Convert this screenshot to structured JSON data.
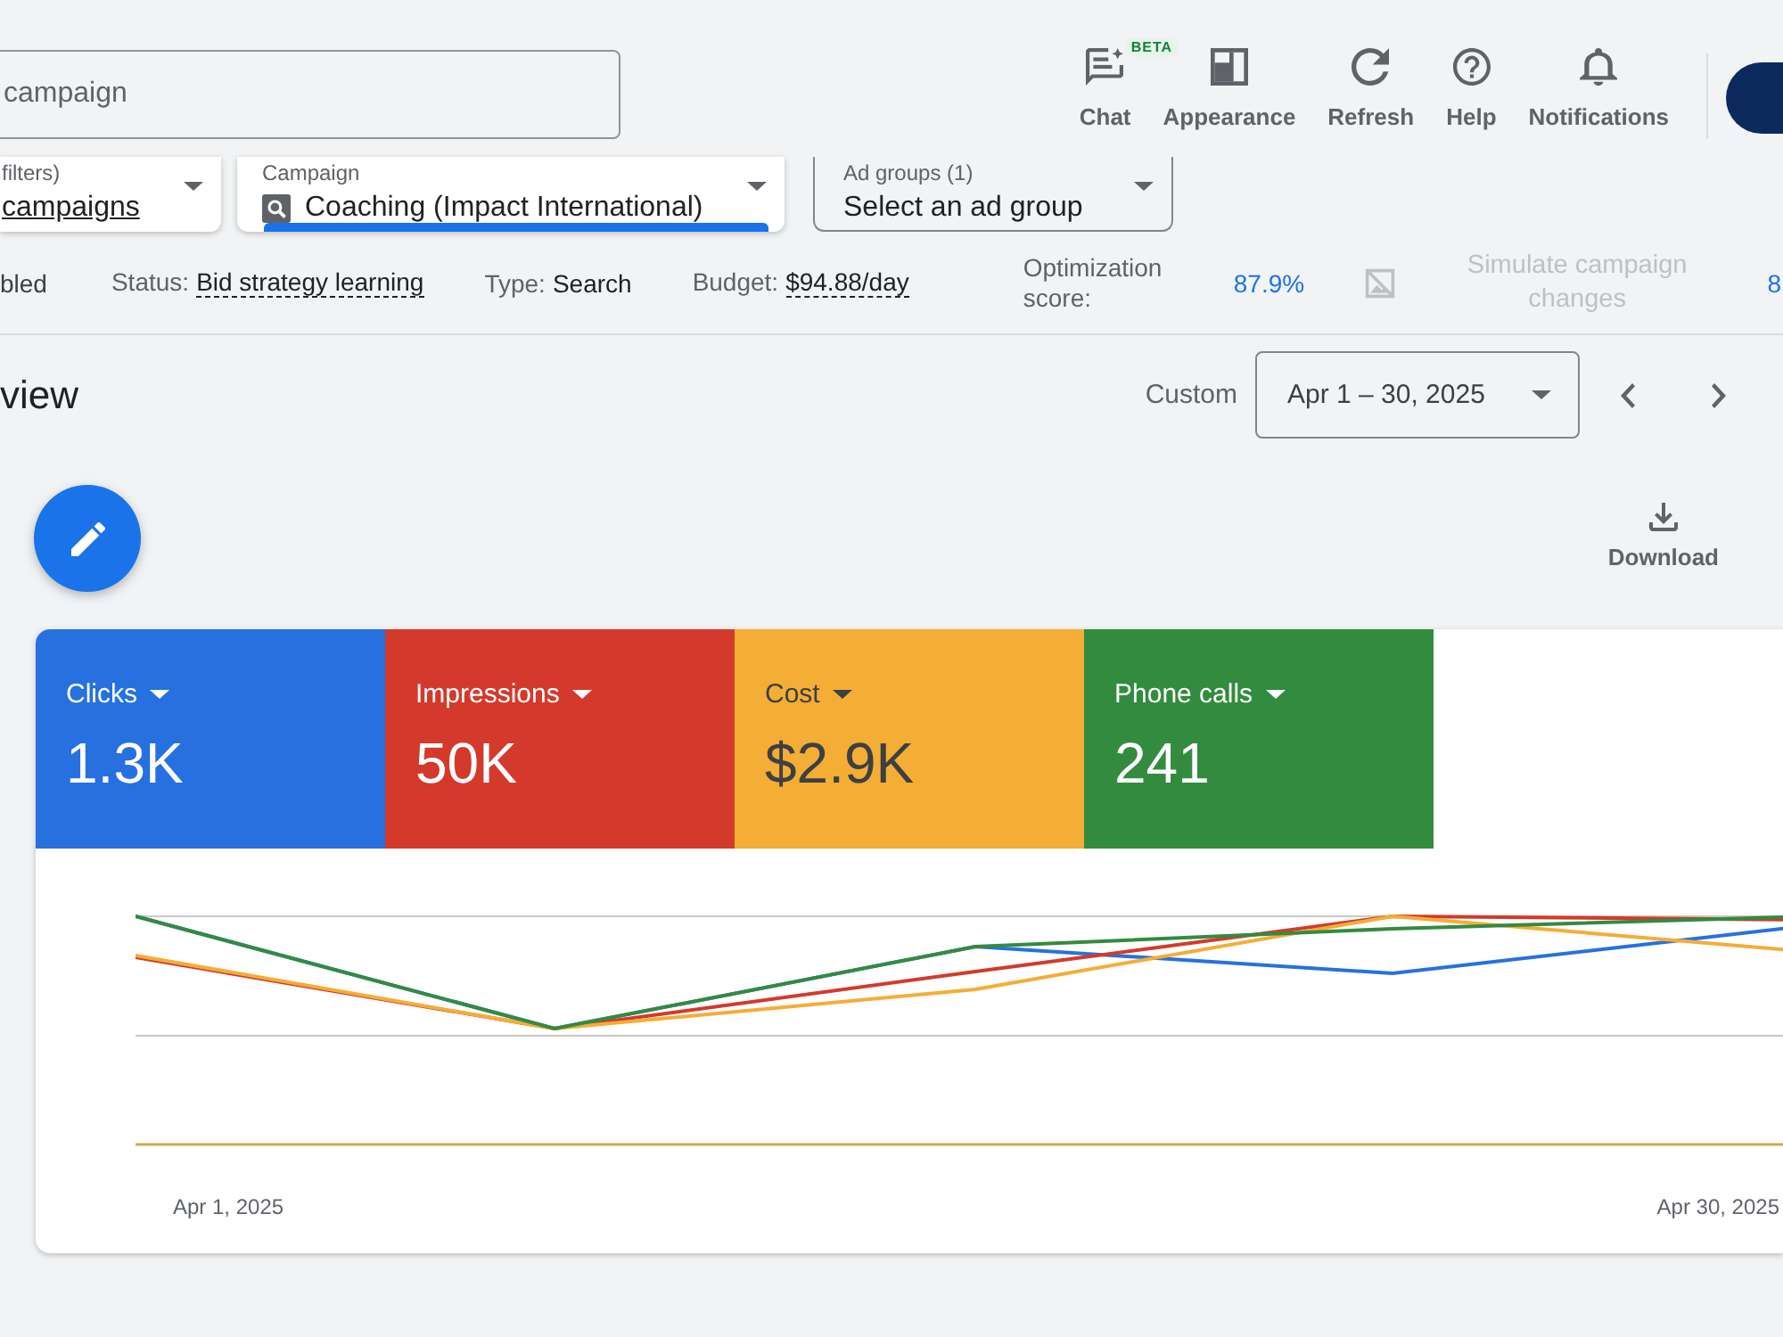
{
  "search": {
    "placeholder": "campaign"
  },
  "toolbar": [
    {
      "label": "Chat",
      "badge": "BETA"
    },
    {
      "label": "Appearance"
    },
    {
      "label": "Refresh"
    },
    {
      "label": "Help"
    },
    {
      "label": "Notifications"
    }
  ],
  "filters": [
    {
      "kind": "filter",
      "label": "filters)",
      "value": "campaigns",
      "selected": false
    },
    {
      "kind": "campaign",
      "label": "Campaign",
      "value": "Coaching (Impact International)",
      "selected": true
    },
    {
      "kind": "ad_group",
      "label": "Ad groups (1)",
      "value": "Select an ad group",
      "selected": false
    }
  ],
  "campaign_info": {
    "state": "bled",
    "details": [
      {
        "label": "Status:",
        "value": "Bid strategy learning",
        "dashed": true
      },
      {
        "label": "Type:",
        "value": "Search",
        "dashed": false
      },
      {
        "label": "Budget:",
        "value": "$94.88/day",
        "dashed": true
      }
    ],
    "optimization_score": {
      "label": "Optimization score:",
      "value": "87.9%"
    },
    "simulate": {
      "label": "Simulate campaign changes",
      "disabled": true
    },
    "trailing": "8"
  },
  "overview": {
    "title": "view",
    "range_label": "Custom",
    "date_range": "Apr 1 – 30, 2025",
    "download": "Download"
  },
  "metrics": [
    {
      "name": "Clicks",
      "value": "1.3K",
      "color": "#2671df"
    },
    {
      "name": "Impressions",
      "value": "50K",
      "color": "#d33a2c"
    },
    {
      "name": "Cost",
      "value": "$2.9K",
      "color": "#f4ad35"
    },
    {
      "name": "Phone calls",
      "value": "241",
      "color": "#338b3f"
    }
  ],
  "chart": {
    "x_labels": [
      "Apr 1, 2025",
      "Apr 30, 2025"
    ]
  }
}
